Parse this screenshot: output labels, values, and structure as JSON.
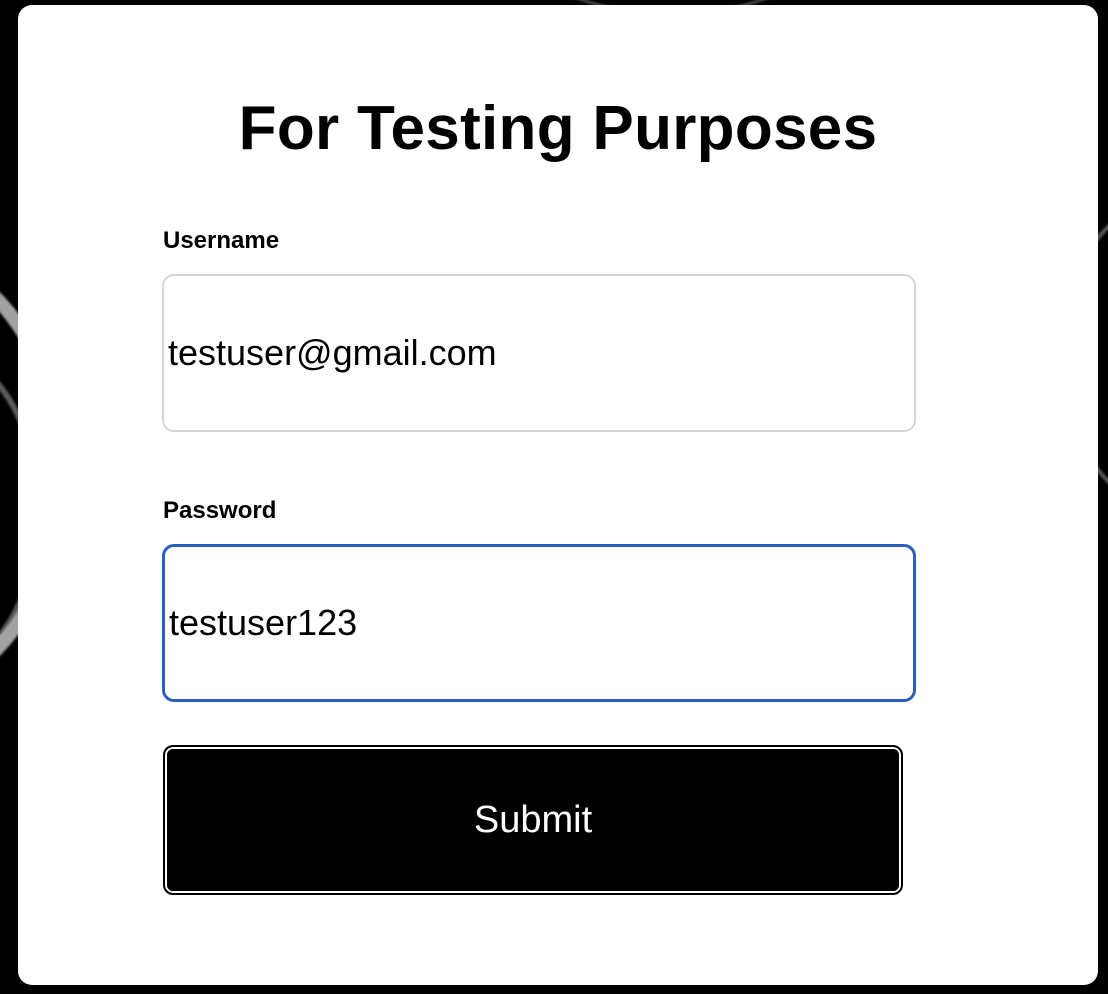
{
  "form": {
    "title": "For Testing Purposes",
    "username": {
      "label": "Username",
      "value": "testuser@gmail.com"
    },
    "password": {
      "label": "Password",
      "value": "testuser123",
      "focused": true
    },
    "submit_label": "Submit"
  },
  "colors": {
    "background": "#000000",
    "card": "#ffffff",
    "focus_border": "#2c5fbb",
    "input_border": "#d6d6d6",
    "button_bg": "#000000",
    "button_text": "#ffffff"
  }
}
